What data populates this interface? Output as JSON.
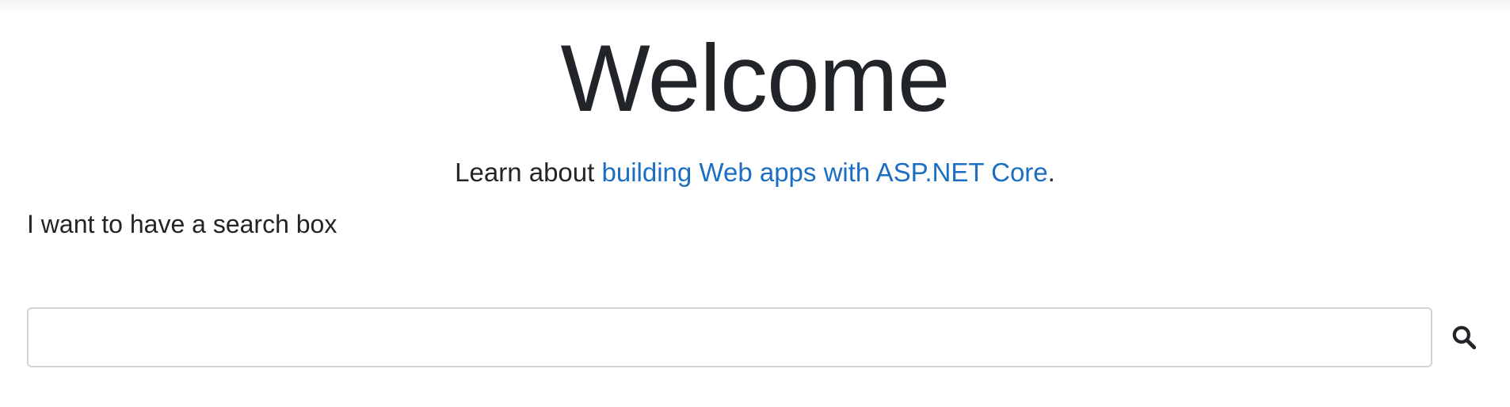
{
  "hero": {
    "title": "Welcome",
    "learn_prefix": "Learn about ",
    "learn_link": "building Web apps with ASP.NET Core",
    "learn_suffix": "."
  },
  "search": {
    "caption": "I want to have a search box",
    "value": "",
    "icon": "search-icon"
  },
  "colors": {
    "text": "#212529",
    "link": "#1b6ec2",
    "input_border": "#cfd4da",
    "background": "#ffffff"
  }
}
